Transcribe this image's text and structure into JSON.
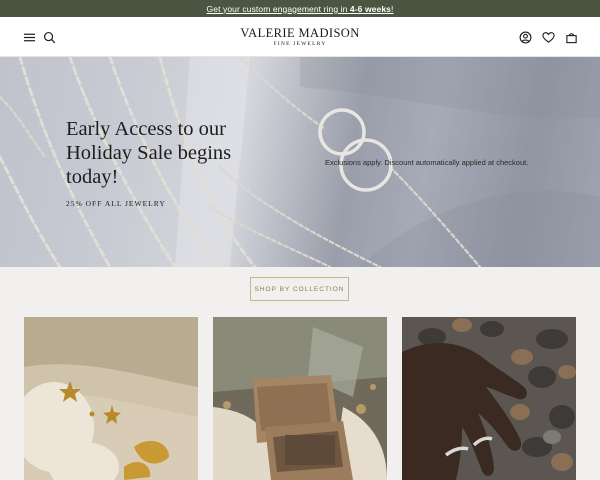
{
  "announcement": {
    "text_before": "Get your custom engagement ring in ",
    "text_bold": "4-6 weeks",
    "text_after": "!"
  },
  "header": {
    "logo_main": "VALERIE MADISON",
    "logo_sub": "FINE JEWELRY",
    "icons": {
      "menu": "menu-icon",
      "search": "search-icon",
      "account": "account-icon",
      "wishlist": "heart-icon",
      "cart": "bag-icon"
    }
  },
  "hero": {
    "title": "Early Access to our Holiday Sale begins today!",
    "subtitle": "25% OFF ALL JEWELRY",
    "note": "Exclusions apply. Discount automatically applied at checkout."
  },
  "cta": {
    "label": "SHOP BY COLLECTION"
  },
  "colors": {
    "announcement_bg": "#4a5641",
    "accent_gold": "#c9b58a",
    "page_bg": "#f2f0ef"
  }
}
